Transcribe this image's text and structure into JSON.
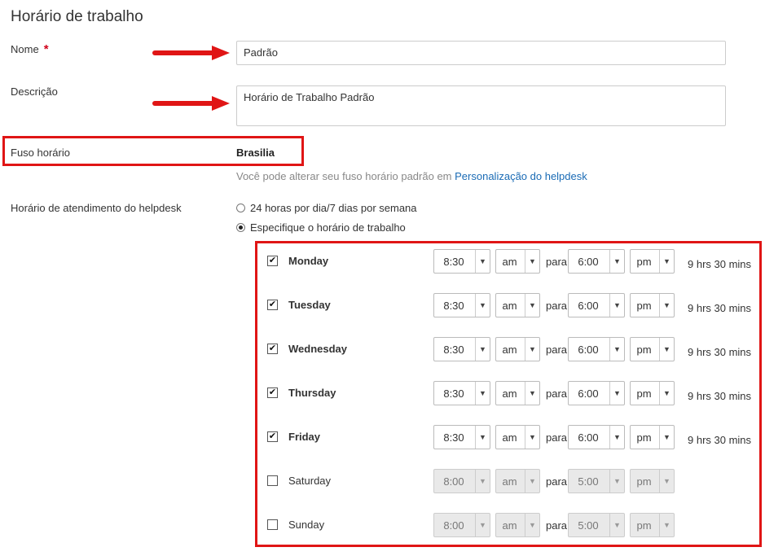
{
  "page": {
    "title": "Horário de trabalho"
  },
  "form": {
    "name_label": "Nome",
    "required_mark": "*",
    "name_value": "Padrão",
    "description_label": "Descrição",
    "description_value": "Horário de Trabalho Padrão",
    "timezone_label": "Fuso horário",
    "timezone_value": "Brasilia",
    "timezone_hint": "Você pode alterar seu fuso horário padrão em",
    "timezone_link": "Personalização do helpdesk",
    "hours_label": "Horário de atendimento do helpdesk",
    "option_24h": "24 horas por dia/7 dias por semana",
    "option_custom": "Especifique o horário de trabalho",
    "selected_option": "custom"
  },
  "schedule": {
    "separator": "para",
    "days": [
      {
        "name": "Monday",
        "enabled": true,
        "start": "8:30",
        "start_ampm": "am",
        "end": "6:00",
        "end_ampm": "pm",
        "total": "9 hrs 30 mins"
      },
      {
        "name": "Tuesday",
        "enabled": true,
        "start": "8:30",
        "start_ampm": "am",
        "end": "6:00",
        "end_ampm": "pm",
        "total": "9 hrs 30 mins"
      },
      {
        "name": "Wednesday",
        "enabled": true,
        "start": "8:30",
        "start_ampm": "am",
        "end": "6:00",
        "end_ampm": "pm",
        "total": "9 hrs 30 mins"
      },
      {
        "name": "Thursday",
        "enabled": true,
        "start": "8:30",
        "start_ampm": "am",
        "end": "6:00",
        "end_ampm": "pm",
        "total": "9 hrs 30 mins"
      },
      {
        "name": "Friday",
        "enabled": true,
        "start": "8:30",
        "start_ampm": "am",
        "end": "6:00",
        "end_ampm": "pm",
        "total": "9 hrs 30 mins"
      },
      {
        "name": "Saturday",
        "enabled": false,
        "start": "8:00",
        "start_ampm": "am",
        "end": "5:00",
        "end_ampm": "pm",
        "total": ""
      },
      {
        "name": "Sunday",
        "enabled": false,
        "start": "8:00",
        "start_ampm": "am",
        "end": "5:00",
        "end_ampm": "pm",
        "total": ""
      }
    ]
  },
  "colors": {
    "highlight": "#e01515",
    "link": "#1a6bb5"
  },
  "icons": {
    "dropdown": "chevron-down-icon",
    "checkmark": "checkmark-icon"
  }
}
